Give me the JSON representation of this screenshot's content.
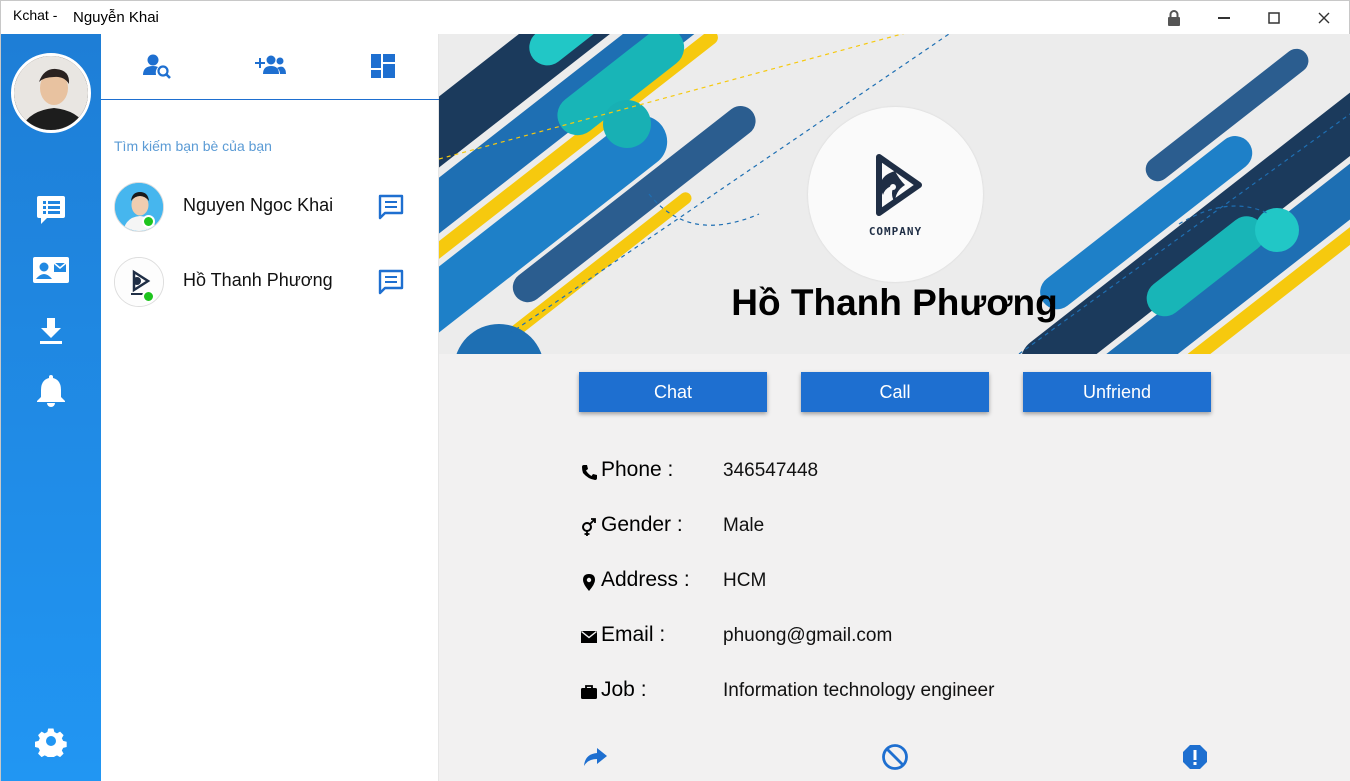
{
  "window": {
    "app_name": "Kchat -",
    "user_name": "Nguyễn Khai"
  },
  "sidebar": {
    "avatar_icon": "user-avatar",
    "nav": [
      {
        "icon": "chat-list-icon"
      },
      {
        "icon": "contact-card-icon"
      },
      {
        "icon": "download-icon"
      },
      {
        "icon": "bell-icon"
      }
    ],
    "settings_icon": "gear-icon"
  },
  "friends_panel": {
    "tabs": [
      {
        "icon": "search-user-icon"
      },
      {
        "icon": "add-friends-icon"
      },
      {
        "icon": "dashboard-icon"
      }
    ],
    "search_hint": "Tìm kiếm bạn bè của bạn",
    "friends": [
      {
        "name": "Nguyen Ngoc Khai",
        "online": true
      },
      {
        "name": "Hồ Thanh Phương",
        "online": true
      }
    ]
  },
  "profile": {
    "name": "Hồ Thanh Phương",
    "logo_text": "COMPANY",
    "buttons": {
      "chat": "Chat",
      "call": "Call",
      "unfriend": "Unfriend"
    },
    "fields": {
      "phone": {
        "label": "Phone :",
        "value": "346547448",
        "icon": "phone-icon"
      },
      "gender": {
        "label": "Gender :",
        "value": "Male",
        "icon": "gender-icon"
      },
      "address": {
        "label": "Address :",
        "value": "HCM",
        "icon": "map-pin-icon"
      },
      "email": {
        "label": "Email :",
        "value": "phuong@gmail.com",
        "icon": "envelope-icon"
      },
      "job": {
        "label": "Job :",
        "value": "Information technology engineer",
        "icon": "briefcase-icon"
      }
    },
    "bottom_actions": [
      {
        "icon": "share-icon"
      },
      {
        "icon": "block-icon"
      },
      {
        "icon": "report-icon"
      }
    ]
  },
  "colors": {
    "primary": "#1e6fd0",
    "rail_top": "#1e7ed6",
    "rail_bottom": "#2196f3",
    "online": "#1ec41e",
    "hint": "#5b9bd5"
  }
}
